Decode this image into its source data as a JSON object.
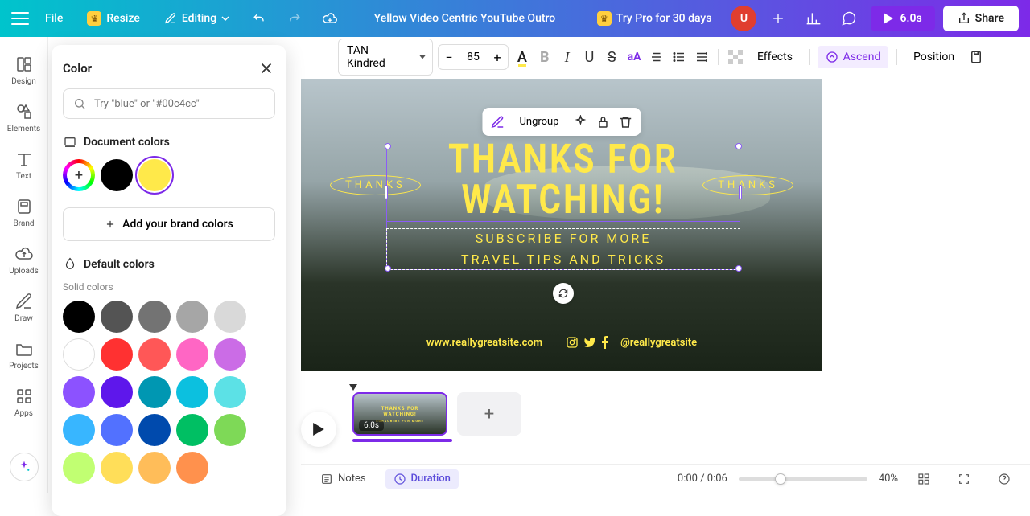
{
  "topbar": {
    "file": "File",
    "resize": "Resize",
    "editing": "Editing",
    "title": "Yellow Video Centric YouTube Outro",
    "try_pro": "Try Pro for 30 days",
    "avatar_initial": "U",
    "play_duration": "6.0s",
    "share": "Share"
  },
  "rail": {
    "design": "Design",
    "elements": "Elements",
    "text": "Text",
    "brand": "Brand",
    "uploads": "Uploads",
    "draw": "Draw",
    "projects": "Projects",
    "apps": "Apps"
  },
  "color_panel": {
    "title": "Color",
    "search_placeholder": "Try \"blue\" or \"#00c4cc\"",
    "doc_colors_label": "Document colors",
    "brand_btn": "Add your brand colors",
    "default_label": "Default colors",
    "solid_label": "Solid colors",
    "doc_colors": [
      "#000000",
      "#ffe94a"
    ],
    "solid_colors": [
      "#000000",
      "#545454",
      "#737373",
      "#a6a6a6",
      "#d9d9d9",
      "#ffffff",
      "#ff3131",
      "#ff5757",
      "#ff66c4",
      "#cb6ce6",
      "#8c52ff",
      "#5e17eb",
      "#0097b2",
      "#0cc0df",
      "#5ce1e6",
      "#38b6ff",
      "#5271ff",
      "#004aad",
      "#00bf63",
      "#7ed957",
      "#c1ff72",
      "#ffde59",
      "#ffbd59",
      "#ff914d"
    ]
  },
  "ctx": {
    "font": "TAN Kindred",
    "size": "85",
    "effects": "Effects",
    "ascend": "Ascend",
    "position": "Position"
  },
  "float": {
    "ungroup": "Ungroup"
  },
  "canvas": {
    "main_line1": "THANKS FOR",
    "main_line2": "WATCHING!",
    "sub_line1": "SUBSCRIBE FOR MORE",
    "sub_line2": "TRAVEL TIPS AND TRICKS",
    "badge_left": "THANKS",
    "badge_right": "THANKS",
    "url": "www.reallygreatsite.com",
    "handle": "@reallygreatsite"
  },
  "timeline": {
    "scene_duration": "6.0s"
  },
  "bottom": {
    "notes": "Notes",
    "duration": "Duration",
    "time": "0:00 / 0:06",
    "zoom": "40%"
  }
}
